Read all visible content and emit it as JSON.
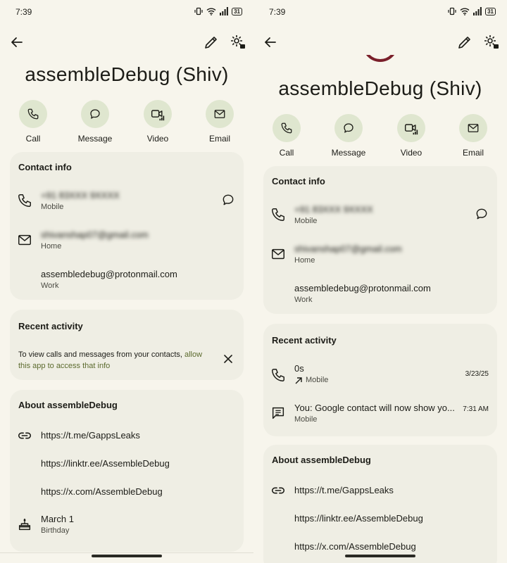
{
  "left": {
    "status": {
      "time": "7:39",
      "battery": "31"
    },
    "name": "assembleDebug (Shiv)",
    "actions": [
      "Call",
      "Message",
      "Video",
      "Email"
    ],
    "contact_info": {
      "title": "Contact info",
      "phone": {
        "value": "+91 83XXX 9XXXX",
        "label": "Mobile"
      },
      "email_home": {
        "value": "shivanshap07@gmail.com",
        "label": "Home"
      },
      "email_work": {
        "value": "assembledebug@protonmail.com",
        "label": "Work"
      }
    },
    "recent_activity": {
      "title": "Recent activity",
      "note_text": "To view calls and messages from your contacts, ",
      "note_link": "allow this app to access that info"
    },
    "about": {
      "title": "About assembleDebug",
      "links": [
        "https://t.me/GappsLeaks",
        "https://linktr.ee/AssembleDebug",
        "https://x.com/AssembleDebug"
      ],
      "birthday": {
        "value": "March 1",
        "label": "Birthday"
      }
    }
  },
  "right": {
    "status": {
      "time": "7:39",
      "battery": "31"
    },
    "name": "assembleDebug (Shiv)",
    "actions": [
      "Call",
      "Message",
      "Video",
      "Email"
    ],
    "contact_info": {
      "title": "Contact info",
      "phone": {
        "value": "+91 83XXX 9XXXX",
        "label": "Mobile"
      },
      "email_home": {
        "value": "shivanshap07@gmail.com",
        "label": "Home"
      },
      "email_work": {
        "value": "assembledebug@protonmail.com",
        "label": "Work"
      }
    },
    "recent_activity": {
      "title": "Recent activity",
      "call": {
        "duration": "0s",
        "label": "Mobile",
        "date": "3/23/25"
      },
      "message": {
        "text": "You: Google contact will now show yo...",
        "label": "Mobile",
        "time": "7:31 AM"
      }
    },
    "about": {
      "title": "About assembleDebug",
      "links": [
        "https://t.me/GappsLeaks",
        "https://linktr.ee/AssembleDebug",
        "https://x.com/AssembleDebug"
      ]
    }
  },
  "icons": [
    "back-arrow-icon",
    "edit-pencil-icon",
    "contact-settings-icon",
    "phone-icon",
    "message-bubble-icon",
    "video-icon",
    "email-icon",
    "close-icon",
    "link-icon",
    "cake-icon",
    "outgoing-call-arrow-icon",
    "sms-icon"
  ],
  "colors": {
    "background": "#f7f5ec",
    "card": "#efeee4",
    "action_circle": "#dfe6cf",
    "link": "#5b6a2d"
  }
}
